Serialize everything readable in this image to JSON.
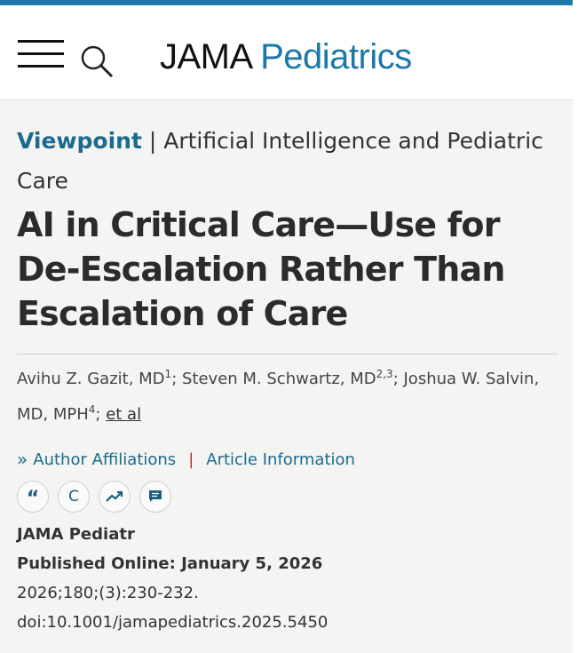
{
  "header": {
    "brand_primary": "JAMA",
    "brand_secondary": "Pediatrics",
    "brand_color": "#1b78a9",
    "menu_icon": "hamburger-menu-icon",
    "search_icon": "search-icon"
  },
  "article": {
    "category_label": "Viewpoint",
    "category_sep": " | ",
    "category_topic": "Artificial Intelligence and Pediatric Care",
    "title": "AI in Critical Care—Use for De-Escalation Rather Than Escalation of Care",
    "authors": [
      {
        "name": "Avihu Z. Gazit, MD",
        "aff": "1"
      },
      {
        "name": "Steven M. Schwartz, MD",
        "aff": "2,3"
      },
      {
        "name": "Joshua W. Salvin, MD, MPH",
        "aff": "4"
      }
    ],
    "author_sep": "; ",
    "et_al": "et al",
    "author_affiliations": "Author Affiliations",
    "article_information": "Article Information",
    "tool_cite": "“",
    "tool_crossref": "C",
    "tool_metrics": "metrics-icon",
    "tool_comment": "comment-icon",
    "journal": "JAMA Pediatr",
    "published_online": "Published Online: January 5, 2026",
    "citation": "2026;180;(3):230-232.",
    "doi": "doi:10.1001/jamapediatrics.2025.5450"
  }
}
